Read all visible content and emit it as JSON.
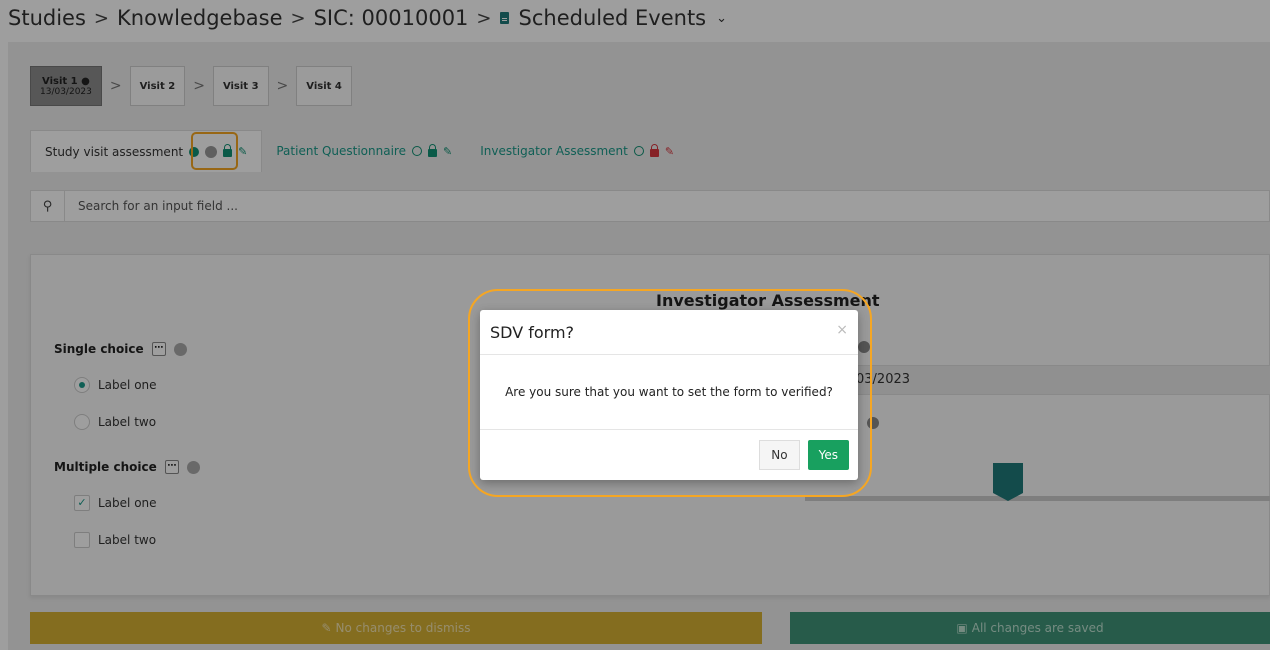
{
  "breadcrumb": {
    "items": [
      "Studies",
      "Knowledgebase",
      "SIC: 00010001",
      "Scheduled Events"
    ],
    "separator": ">"
  },
  "visits": [
    {
      "label": "Visit 1",
      "date": "13/03/2023",
      "active": true
    },
    {
      "label": "Visit 2"
    },
    {
      "label": "Visit 3"
    },
    {
      "label": "Visit 4"
    }
  ],
  "tabs": [
    {
      "label": "Study visit assessment"
    },
    {
      "label": "Patient Questionnaire"
    },
    {
      "label": "Investigator Assessment"
    }
  ],
  "search": {
    "placeholder": "Search for an input field ..."
  },
  "form": {
    "title": "Investigator Assessment",
    "single_choice": {
      "label": "Single choice",
      "options": [
        "Label one",
        "Label two"
      ],
      "selected": "Label one"
    },
    "multiple_choice": {
      "label": "Multiple choice",
      "options": [
        "Label one",
        "Label two"
      ],
      "checked": [
        "Label one"
      ]
    },
    "date_value": "03/2023"
  },
  "buttons": {
    "dismiss": "No changes to dismiss",
    "saved": "All changes are saved"
  },
  "modal": {
    "title": "SDV form?",
    "close": "×",
    "message": "Are you sure that you want to set the form to verified?",
    "no": "No",
    "yes": "Yes"
  },
  "colors": {
    "accent": "#1a9a8a",
    "green": "#119174",
    "red": "#d9363e",
    "yes_button": "#18a05f",
    "highlight": "#f5a623",
    "dismiss_button": "#d6b032",
    "saved_button": "#3f9478"
  },
  "icons": [
    "users-icon",
    "file-icon",
    "chevron-down-icon",
    "search-icon",
    "lock-icon",
    "pencil-icon",
    "check-circle-icon",
    "save-icon",
    "eraser-icon",
    "close-icon"
  ]
}
